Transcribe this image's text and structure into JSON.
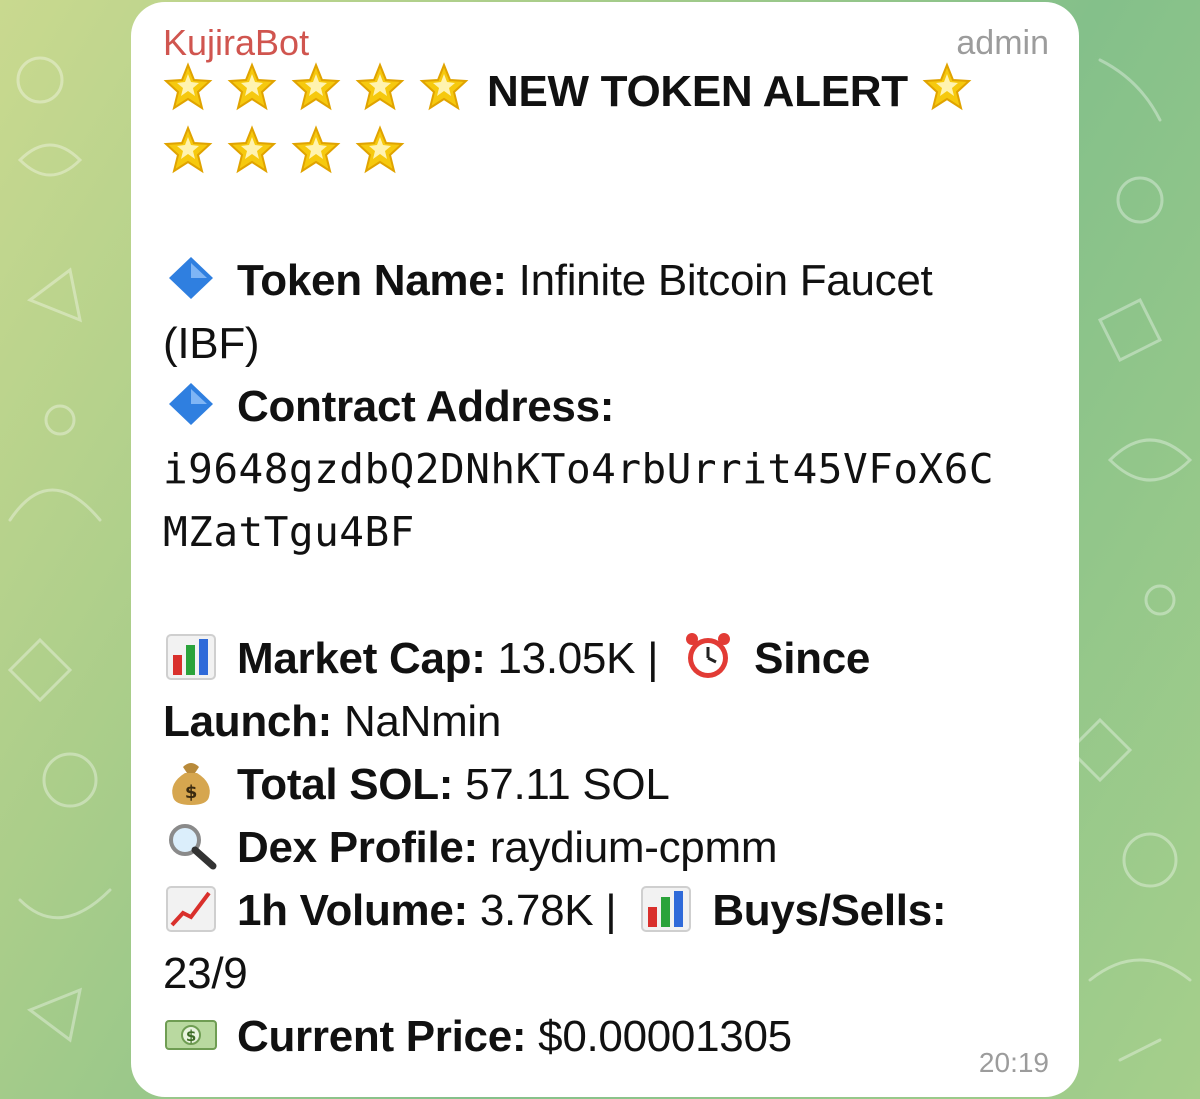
{
  "message": {
    "sender": "KujiraBot",
    "role": "admin",
    "time": "20:19",
    "alert_title": "NEW TOKEN ALERT",
    "token_name_label": "Token Name:",
    "token_name_value": "Infinite Bitcoin Faucet",
    "token_name_value_line2": "(IBF)",
    "contract_label": "Contract Address:",
    "contract_line1": "i9648gzdbQ2DNhKTo4rbUrrit45VFoX6C",
    "contract_line2": "MZatTgu4BF",
    "market_cap_label": "Market Cap:",
    "market_cap_value": "13.05K |",
    "since_label_1": "Since",
    "since_label_2": "Launch:",
    "since_value": "NaNmin",
    "total_sol_label": "Total SOL:",
    "total_sol_value": "57.11 SOL",
    "dex_label": "Dex Profile:",
    "dex_value": "raydium-cpmm",
    "volume_label": "1h Volume:",
    "volume_value": "3.78K |",
    "buys_sells_label": "Buys/Sells:",
    "buys_sells_value": "23/9",
    "price_label": "Current Price:",
    "price_value": "$0.00001305"
  },
  "icons": {
    "star": "star-emoji-icon",
    "diamond": "blue-diamond-icon",
    "chart": "bar-chart-icon",
    "clock": "alarm-clock-icon",
    "money_bag": "money-bag-icon",
    "magnifier": "magnifying-glass-icon",
    "trend": "chart-increasing-icon",
    "banknote": "dollar-banknote-icon"
  },
  "colors": {
    "sender": "#d0554f",
    "muted": "#9c9c9c",
    "bubble": "#ffffff",
    "star": "#f6c90e",
    "diamond": "#2f7fe0"
  }
}
